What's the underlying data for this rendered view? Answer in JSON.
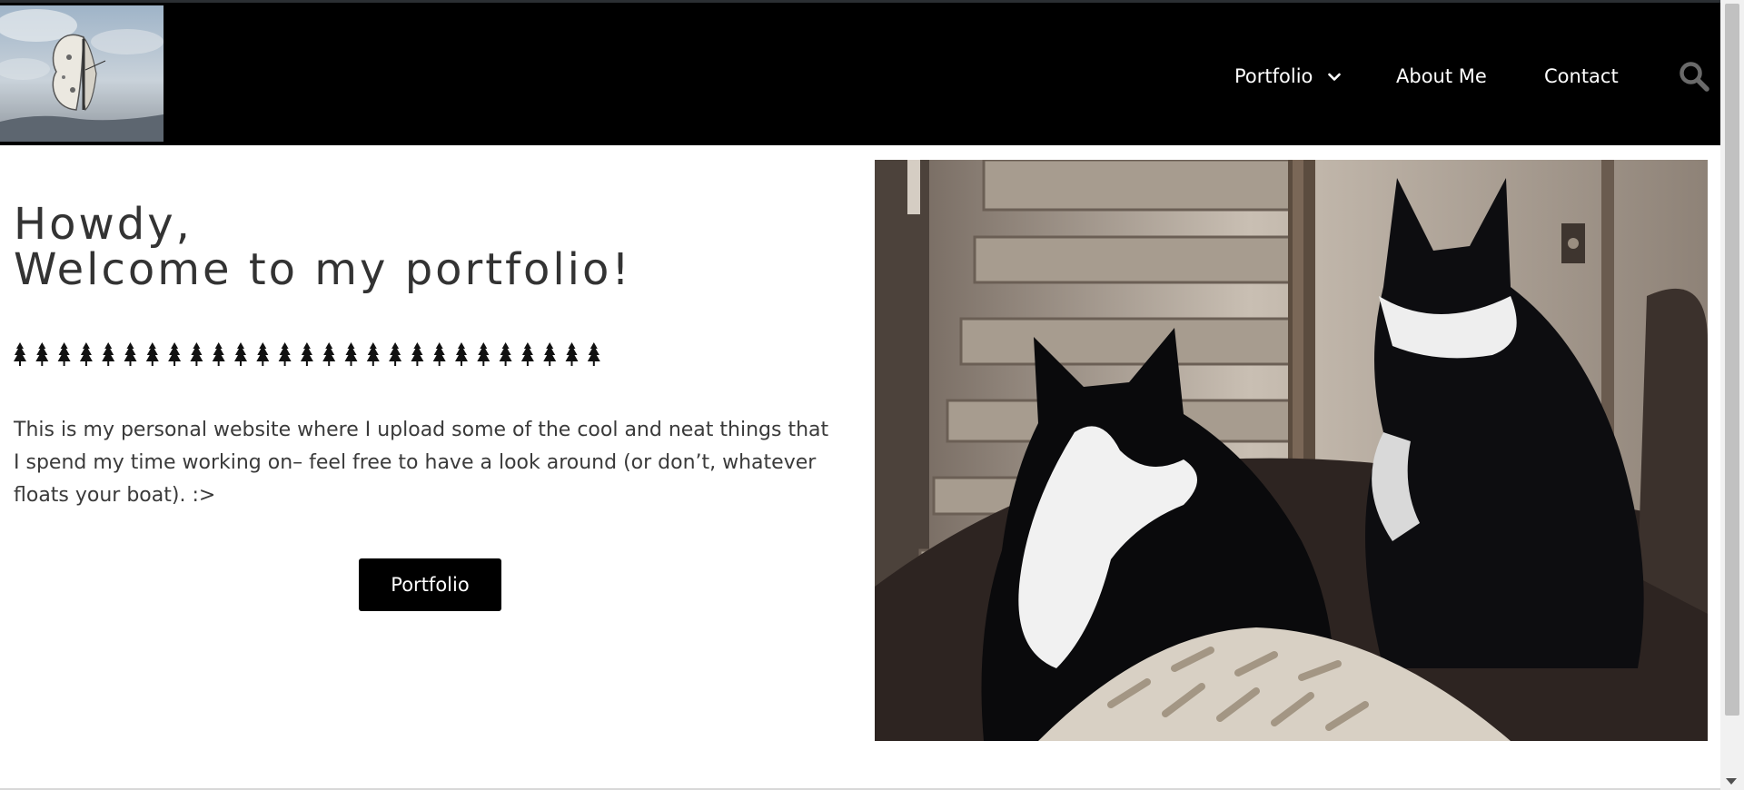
{
  "header": {
    "logo_alt": "butterfly logo",
    "nav": [
      {
        "label": "Portfolio",
        "has_dropdown": true
      },
      {
        "label": "About Me"
      },
      {
        "label": "Contact"
      }
    ],
    "search_icon": "search-icon"
  },
  "hero": {
    "heading_line1": "Howdy,",
    "heading_line2": "Welcome to my portfolio!",
    "divider_icon": "tree-icon",
    "divider_count": 27,
    "intro": "This is my personal website where I upload some of the cool and neat things that I spend my time working on– feel free to have a look around (or don’t, whatever floats your boat).  :>",
    "cta_label": "Portfolio"
  },
  "photo": {
    "description_icon": "two-dogs-photo"
  },
  "colors": {
    "header_bg": "#000000",
    "nav_text": "#ffffff",
    "search_icon": "#6a6a6a",
    "heading_text": "#333333",
    "body_text": "#3a3a3a",
    "button_bg": "#000000",
    "button_text": "#ffffff"
  }
}
